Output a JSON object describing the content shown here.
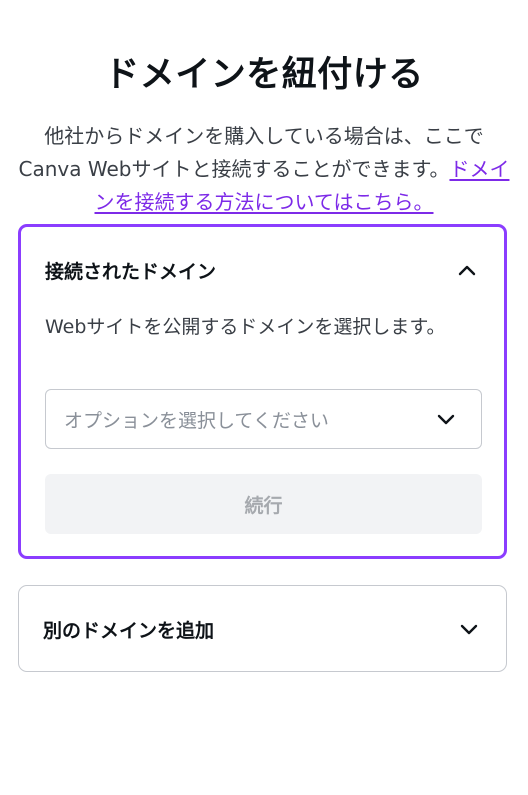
{
  "page": {
    "title": "ドメインを紐付ける",
    "intro_text": "他社からドメインを購入している場合は、ここでCanva Webサイトと接続することができます。",
    "intro_link": "ドメインを接続する方法についてはこちら。"
  },
  "connected_panel": {
    "title": "接続されたドメイン",
    "description": "Webサイトを公開するドメインを選択します。",
    "select_placeholder": "オプションを選択してください",
    "continue_label": "続行",
    "expanded": true
  },
  "add_panel": {
    "title": "別のドメインを追加",
    "expanded": false
  },
  "colors": {
    "accent": "#8b3dff",
    "link": "#7d2ae8",
    "disabled_bg": "#f2f3f5"
  }
}
